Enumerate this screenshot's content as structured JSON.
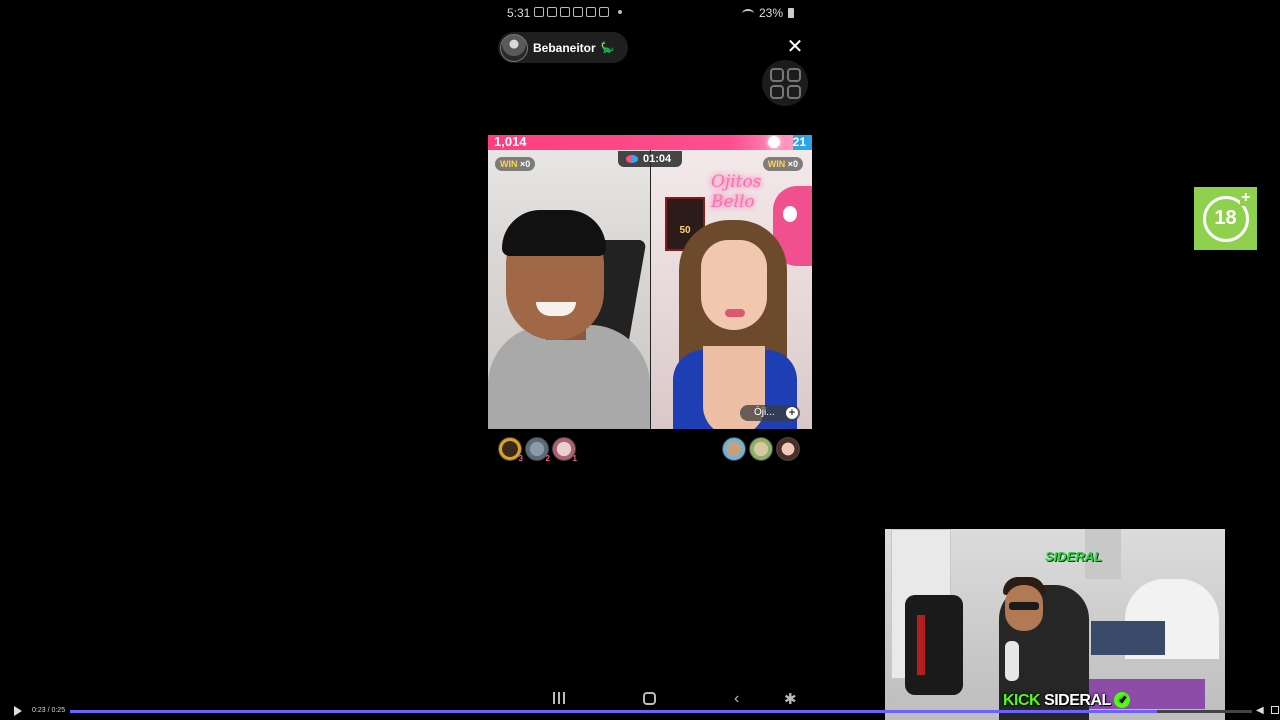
{
  "status_bar": {
    "time": "5:31",
    "battery": "23%"
  },
  "host": {
    "name": "Bebaneitor",
    "badge_icon": "dinosaur-icon"
  },
  "battle": {
    "left_score": "1,014",
    "right_score": "21",
    "left_share": 0.94,
    "timer": "01:04",
    "win_label": "WIN",
    "left_win_count": "×0",
    "right_win_count": "×0",
    "right_neon_text": "Ojitos Bello",
    "right_poster_text": "50",
    "opponent_chip_label": "Òji..."
  },
  "supporters": {
    "left": [
      {
        "rank": "3"
      },
      {
        "rank": "2"
      },
      {
        "rank": "1"
      }
    ],
    "right": [
      {
        "rank": ""
      },
      {
        "rank": ""
      },
      {
        "rank": ""
      }
    ]
  },
  "age_badge": {
    "label": "18"
  },
  "webcam": {
    "brand_kick": "KICK",
    "brand_name": "SIDERAL",
    "logo_text": "SIDERAL"
  },
  "player": {
    "time": "0:23 / 0:25",
    "progress": 0.92
  },
  "colors": {
    "left_team": "#ff3d7f",
    "right_team": "#2aa6e8",
    "kick_green": "#53fc18",
    "age_badge": "#8fd14f",
    "progress": "#6c63ff"
  }
}
